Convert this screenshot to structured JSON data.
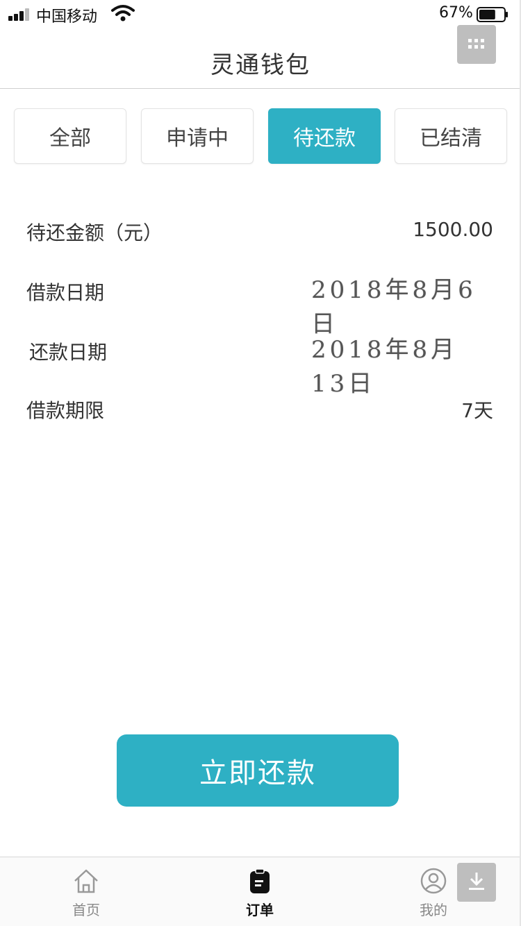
{
  "status_bar": {
    "carrier": "中国移动",
    "battery_percent": "67%",
    "battery_level": 0.67,
    "signal_icon": "cellular-signal-icon",
    "wifi_icon": "wifi-icon"
  },
  "header": {
    "title": "灵通钱包",
    "menu_icon": "grid-icon"
  },
  "tabs": [
    {
      "label": "全部",
      "active": false
    },
    {
      "label": "申请中",
      "active": false
    },
    {
      "label": "待还款",
      "active": true
    },
    {
      "label": "已结清",
      "active": false
    }
  ],
  "details": {
    "amount_label": "待还金额（元）",
    "amount_value": "1500.00",
    "borrow_date_label": "借款日期",
    "borrow_date_value": "2018年8月6日",
    "repay_date_label": "还款日期",
    "repay_date_value": "2018年8月13日",
    "term_label": "借款期限",
    "term_value": "7天"
  },
  "actions": {
    "repay_now": "立即还款"
  },
  "tabbar": {
    "items": [
      {
        "label": "首页",
        "icon": "home-icon",
        "active": false
      },
      {
        "label": "订单",
        "icon": "clipboard-icon",
        "active": true
      },
      {
        "label": "我的",
        "icon": "user-icon",
        "active": false
      }
    ],
    "download_icon": "download-icon"
  },
  "colors": {
    "accent": "#2eb0c4",
    "text": "#333333",
    "muted": "#888888"
  }
}
